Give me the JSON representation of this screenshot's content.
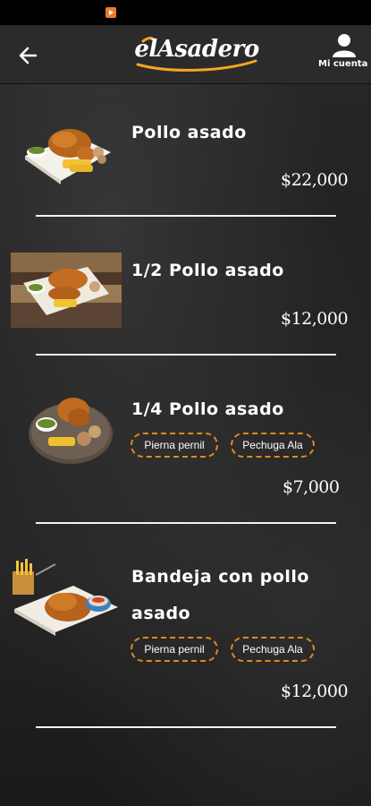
{
  "header": {
    "logo_text": "elAsadero",
    "account_label": "Mi cuenta"
  },
  "colors": {
    "accent": "#e08a1a",
    "header_bg": "#2b2b2b",
    "background": "#1f1f1f"
  },
  "products": [
    {
      "name": "Pollo asado",
      "price": "$22,000"
    },
    {
      "name": "1/2 Pollo asado",
      "price": "$12,000"
    },
    {
      "name": "1/4 Pollo asado",
      "price": "$7,000",
      "options": [
        "Pierna pernil",
        "Pechuga Ala"
      ]
    },
    {
      "name_line1": "Bandeja con pollo",
      "name_line2": "asado",
      "price": "$12,000",
      "options": [
        "Pierna pernil",
        "Pechuga Ala"
      ]
    }
  ]
}
